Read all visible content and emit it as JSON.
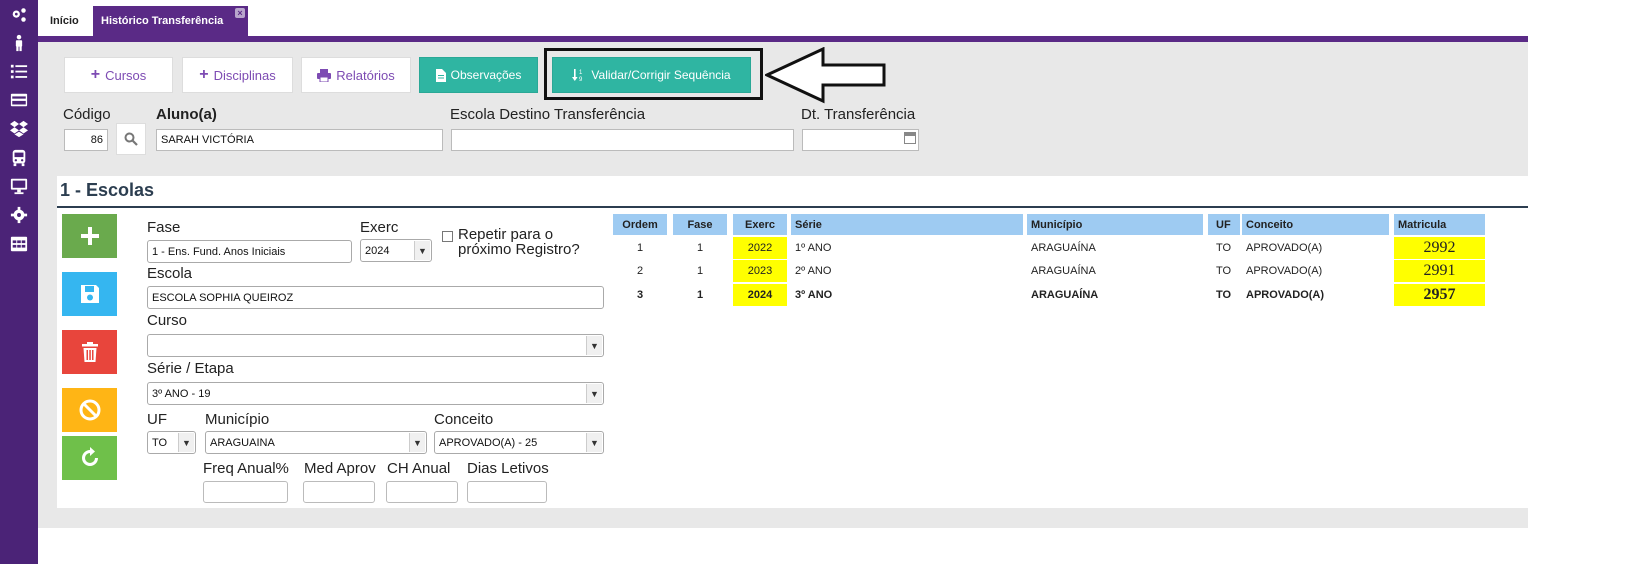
{
  "tabs": {
    "home": "Início",
    "active": "Histórico Transferência",
    "close": "×"
  },
  "sidebar": [
    "gears-icon",
    "person-icon",
    "list-icon",
    "card-icon",
    "dropbox-icon",
    "bus-icon",
    "monitor-icon",
    "gear-icon",
    "table-icon"
  ],
  "toolbar": {
    "cursos": "Cursos",
    "disciplinas": "Disciplinas",
    "relatorios": "Relatórios",
    "observacoes": "Observações",
    "validar": "Validar/Corrigir Sequência"
  },
  "header_form": {
    "codigo_label": "Código",
    "codigo_value": "86",
    "aluno_label": "Aluno(a)",
    "aluno_value": "SARAH VICTÓRIA",
    "escola_destino_label": "Escola Destino Transferência",
    "escola_destino_value": "",
    "dt_transferencia_label": "Dt. Transferência",
    "dt_transferencia_value": ""
  },
  "section": {
    "title": "1 - Escolas"
  },
  "form": {
    "fase_label": "Fase",
    "fase_value": "1 - Ens. Fund. Anos Iniciais",
    "exerc_label": "Exerc",
    "exerc_value": "2024",
    "repetir_label_1": "Repetir para o",
    "repetir_label_2": "próximo Registro?",
    "escola_label": "Escola",
    "escola_value": "ESCOLA SOPHIA QUEIROZ",
    "curso_label": "Curso",
    "curso_value": "",
    "serie_label": "Série / Etapa",
    "serie_value": "3º ANO - 19",
    "uf_label": "UF",
    "uf_value": "TO",
    "municipio_label": "Município",
    "municipio_value": "ARAGUAINA",
    "conceito_label": "Conceito",
    "conceito_value": "APROVADO(A) - 25",
    "freq_label": "Freq Anual%",
    "med_label": "Med Aprov",
    "ch_label": "CH Anual",
    "dias_label": "Dias Letivos"
  },
  "action_buttons": [
    {
      "name": "add-button",
      "icon": "plus-icon",
      "color": "#6aaa4d"
    },
    {
      "name": "save-button",
      "icon": "floppy-icon",
      "color": "#35b6f0"
    },
    {
      "name": "delete-button",
      "icon": "trash-icon",
      "color": "#e8453c"
    },
    {
      "name": "cancel-button",
      "icon": "ban-icon",
      "color": "#ffb515"
    },
    {
      "name": "refresh-button",
      "icon": "refresh-icon",
      "color": "#6fc04a"
    }
  ],
  "grid": {
    "headers": [
      "Ordem",
      "Fase",
      "Exerc",
      "Série",
      "Município",
      "UF",
      "Conceito",
      "Matricula"
    ],
    "rows": [
      {
        "ordem": "1",
        "fase": "1",
        "exerc": "2022",
        "serie": "1º ANO",
        "municipio": "ARAGUAÍNA",
        "uf": "TO",
        "conceito": "APROVADO(A)",
        "matricula": "2992"
      },
      {
        "ordem": "2",
        "fase": "1",
        "exerc": "2023",
        "serie": "2º ANO",
        "municipio": "ARAGUAÍNA",
        "uf": "TO",
        "conceito": "APROVADO(A)",
        "matricula": "2991"
      },
      {
        "ordem": "3",
        "fase": "1",
        "exerc": "2024",
        "serie": "3º ANO",
        "municipio": "ARAGUAÍNA",
        "uf": "TO",
        "conceito": "APROVADO(A)",
        "matricula": "2957"
      }
    ]
  },
  "colors": {
    "purple": "#5a2a86",
    "teal": "#2fb5a2",
    "header_blue": "#9ecbf2",
    "highlight_yellow": "#ffff00"
  }
}
